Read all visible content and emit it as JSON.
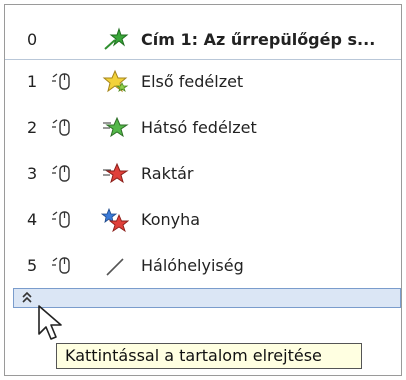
{
  "rows": [
    {
      "num": "0",
      "label": "Cím 1: Az űrrepülőgép s...",
      "icon": "star-icon-green"
    },
    {
      "num": "1",
      "label": "Első fedélzet",
      "icon": "star-icon-yellow"
    },
    {
      "num": "2",
      "label": "Hátsó fedélzet",
      "icon": "star-icon-green"
    },
    {
      "num": "3",
      "label": "Raktár",
      "icon": "star-icon-red"
    },
    {
      "num": "4",
      "label": "Konyha",
      "icon": "star-icon-multi"
    },
    {
      "num": "5",
      "label": "Hálóhelyiség",
      "icon": "line-icon"
    }
  ],
  "collapse": {
    "glyph": "«"
  },
  "tooltip": {
    "text": "Kattintással a tartalom elrejtése"
  },
  "colors": {
    "collapse_bar": "#dbe6f5",
    "tooltip_bg": "#ffffe1"
  }
}
